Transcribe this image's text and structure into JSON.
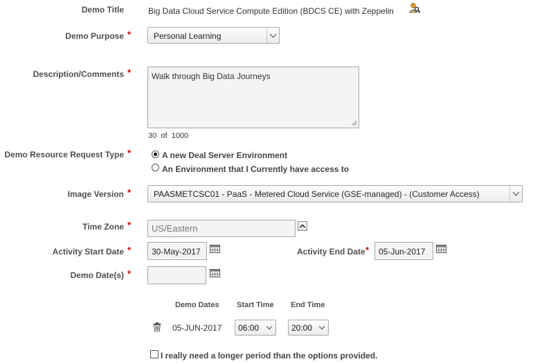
{
  "fields": {
    "demo_title": {
      "label": "Demo Title",
      "value": "Big Data Cloud Service Compute Edition (BDCS CE) with Zeppelin"
    },
    "demo_purpose": {
      "label": "Demo Purpose",
      "required": "*",
      "value": "Personal Learning"
    },
    "description": {
      "label": "Description/Comments",
      "required": "*",
      "value": "Walk through Big Data Journeys",
      "counter": "30  of  1000"
    },
    "resource_request_type": {
      "label": "Demo Resource Request Type",
      "required": "*",
      "options": [
        {
          "label": "A new Deal Server Environment",
          "selected": true
        },
        {
          "label": "An Environment that I Currently have access to",
          "selected": false
        }
      ]
    },
    "image_version": {
      "label": "Image Version",
      "required": "*",
      "value": "PAASMETCSC01 - PaaS - Metered Cloud Service (GSE-managed) - (Customer Access)"
    },
    "time_zone": {
      "label": "Time Zone",
      "required": "*",
      "value": "US/Eastern"
    },
    "activity_start_date": {
      "label": "Activity Start Date",
      "required": "*",
      "value": "30-May-2017"
    },
    "activity_end_date": {
      "label": "Activity End Date",
      "required": "*",
      "value": "05-Jun-2017"
    },
    "demo_dates": {
      "label": "Demo Date(s)",
      "required": "*",
      "value": ""
    }
  },
  "demo_table": {
    "headers": [
      "Demo Dates",
      "Start Time",
      "End Time"
    ],
    "rows": [
      {
        "date": "05-JUN-2017",
        "start": "06:00",
        "end": "20:00"
      }
    ]
  },
  "longer_period": {
    "label": "I really need a longer period than the options provided.",
    "checked": false
  },
  "icons": {
    "title_icon": "user-lookup-icon",
    "calendar": "calendar-icon",
    "trash": "trash-icon",
    "timezone_toggle": "chevron-up-icon"
  }
}
